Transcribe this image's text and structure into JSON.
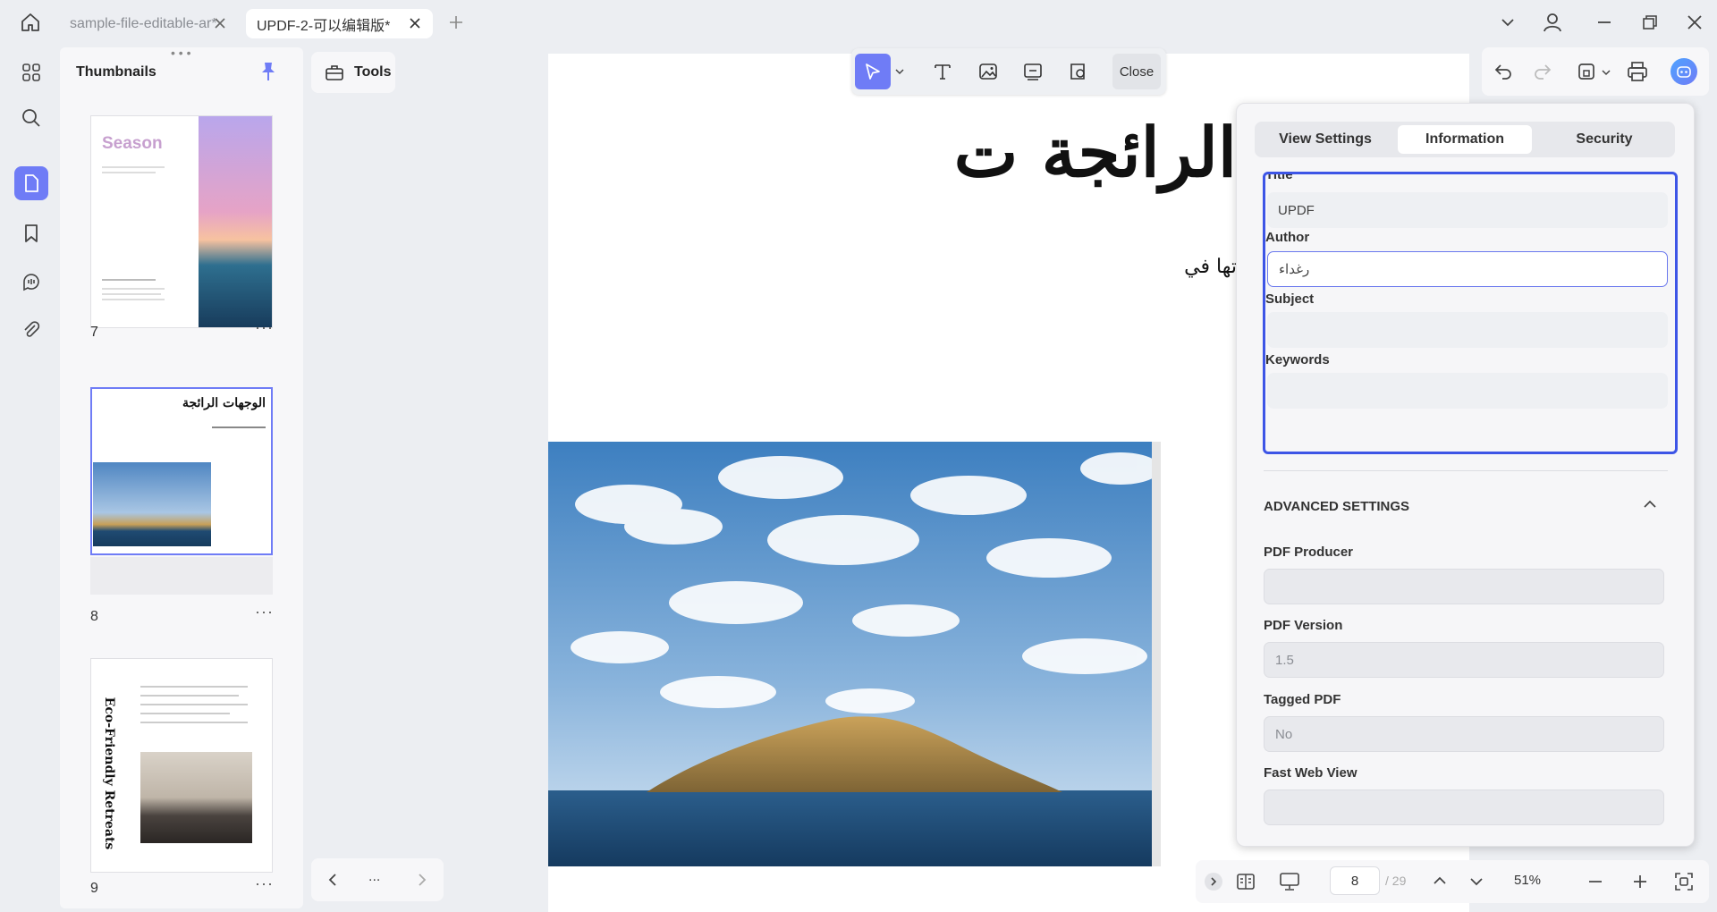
{
  "tabs": [
    {
      "label": "sample-file-editable-ar*",
      "active": false
    },
    {
      "label": "UPDF-2-可以编辑版*",
      "active": true
    }
  ],
  "rail_icons": [
    "grid-icon",
    "search-icon",
    "pages-icon",
    "bookmark-icon",
    "comments-icon",
    "attachment-icon"
  ],
  "thumbnails": {
    "title": "Thumbnails",
    "pages": [
      {
        "number": "7",
        "heading": "Season"
      },
      {
        "number": "8",
        "heading": "الوجهات الرائجة"
      },
      {
        "number": "9",
        "heading": "Eco-Friendly Retreats"
      }
    ]
  },
  "tools": {
    "label": "Tools"
  },
  "edit_toolbar": {
    "close_label": "Close"
  },
  "document": {
    "title": "الرائجة ت",
    "subtitle": "تها في"
  },
  "properties": {
    "tabs": [
      "View Settings",
      "Information",
      "Security"
    ],
    "active_tab": "Information",
    "fields": {
      "title_label": "Title",
      "title_value": "UPDF",
      "author_label": "Author",
      "author_value": "رغداء",
      "subject_label": "Subject",
      "subject_value": "",
      "keywords_label": "Keywords",
      "keywords_value": ""
    },
    "advanced": {
      "heading": "ADVANCED SETTINGS",
      "producer_label": "PDF Producer",
      "producer_value": "",
      "version_label": "PDF Version",
      "version_value": "1.5",
      "tagged_label": "Tagged PDF",
      "tagged_value": "No",
      "fastweb_label": "Fast Web View",
      "fastweb_value": ""
    }
  },
  "navigation": {
    "more": "..."
  },
  "status": {
    "current_page": "8",
    "total_pages": "/ 29",
    "zoom": "51%"
  },
  "colors": {
    "accent": "#6f7cf6",
    "focus": "#3d55e6"
  }
}
